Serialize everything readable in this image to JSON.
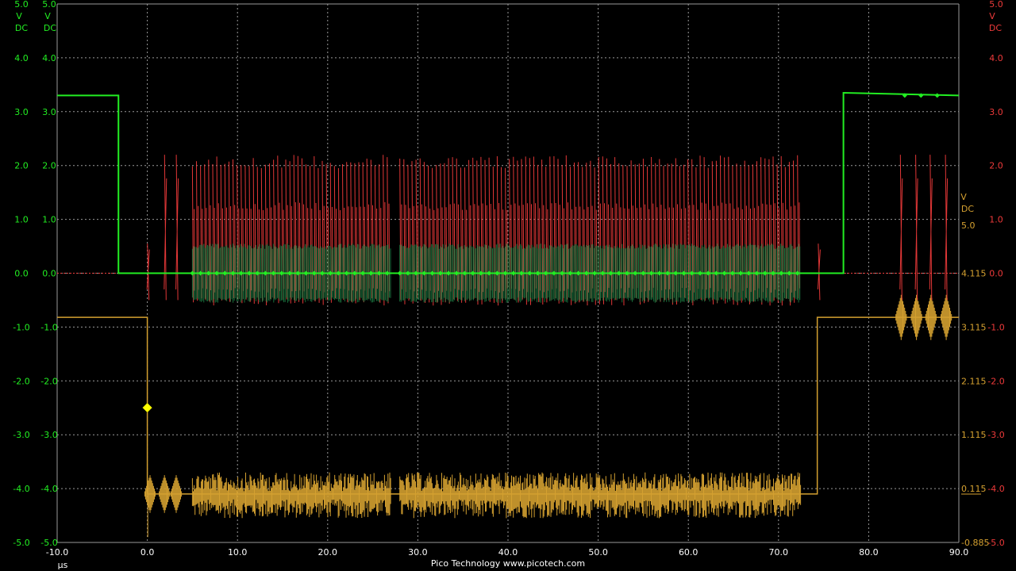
{
  "footer": "Pico Technology  www.picotech.com",
  "colors": {
    "background": "#000000",
    "grid": "#9a9a9a",
    "channel_a": "#22ee22",
    "channel_b": "#ee3a3a",
    "channel_c": "#d4a030",
    "trigger_marker": "#ffff00"
  },
  "chart_data": {
    "type": "line",
    "title": "",
    "grid": true,
    "x": {
      "unit_label": "µs",
      "range": [
        -10,
        90
      ],
      "ticks": [
        "-10.0",
        "0.0",
        "10.0",
        "20.0",
        "30.0",
        "40.0",
        "50.0",
        "60.0",
        "70.0",
        "80.0",
        "90.0"
      ]
    },
    "axes": [
      {
        "id": "A",
        "side": "left",
        "color": "#22ee22",
        "unit": [
          "V",
          "DC"
        ],
        "range": [
          -5,
          5
        ],
        "ticks": [
          "5.0",
          "4.0",
          "3.0",
          "2.0",
          "1.0",
          "0.0",
          "-1.0",
          "-2.0",
          "-3.0",
          "-4.0",
          "-5.0"
        ]
      },
      {
        "id": "A2",
        "side": "left",
        "color": "#22ee22",
        "unit": [
          "V",
          "DC"
        ],
        "range": [
          -5,
          5
        ],
        "ticks": [
          "5.0",
          "4.0",
          "3.0",
          "2.0",
          "1.0",
          "0.0",
          "-1.0",
          "-2.0",
          "-3.0",
          "-4.0",
          "-5.0"
        ]
      },
      {
        "id": "C",
        "side": "right-inner",
        "color": "#d4a030",
        "unit": [
          "V",
          "DC"
        ],
        "range": [
          -0.885,
          5.0
        ],
        "ticks": [
          "5.0",
          "4.115",
          "3.115",
          "2.115",
          "1.115",
          "0.115",
          "-0.885"
        ]
      },
      {
        "id": "B",
        "side": "right",
        "color": "#ee3a3a",
        "unit": [
          "V",
          "DC"
        ],
        "range": [
          -5,
          5
        ],
        "ticks": [
          "5.0",
          "4.0",
          "3.0",
          "2.0",
          "1.0",
          "0.0",
          "-1.0",
          "-2.0",
          "-3.0",
          "-4.0",
          "-5.0"
        ]
      }
    ],
    "trigger": {
      "x": 0.0,
      "y": -2.1,
      "axis": "A"
    },
    "series": [
      {
        "channel": "A",
        "color": "#22ee22",
        "baseline_points": [
          [
            -10,
            3.3
          ],
          [
            -3.2,
            3.3
          ],
          [
            -3.2,
            0.0
          ],
          [
            77.2,
            0.0
          ],
          [
            77.2,
            3.35
          ],
          [
            90,
            3.3
          ]
        ],
        "activity_windows": [
          [
            5,
            27
          ],
          [
            28,
            72.5
          ]
        ],
        "activity_amplitude": [
          -0.1,
          0.1
        ]
      },
      {
        "channel": "B",
        "color": "#ee3a3a",
        "baseline": 0.0,
        "burst_windows": [
          [
            5,
            27
          ],
          [
            28,
            72.5
          ]
        ],
        "burst_period": 0.45,
        "burst_peak": 2.2,
        "burst_trough": -0.6,
        "isolated_spikes": [
          0.1,
          2.0,
          3.3,
          74.5,
          83.6,
          85.3,
          86.9,
          88.6
        ],
        "isolated_spike_peak": 2.2
      },
      {
        "channel": "C",
        "color": "#d4a030",
        "baseline_points": [
          [
            -10,
            -0.82
          ],
          [
            0.0,
            -0.82
          ],
          [
            0.0,
            -4.1
          ],
          [
            74.3,
            -4.1
          ],
          [
            74.3,
            -0.82
          ],
          [
            90,
            -0.82
          ]
        ],
        "noise_windows": [
          [
            5,
            27
          ],
          [
            28,
            72.5
          ]
        ],
        "noise_range": [
          -4.55,
          -3.7
        ],
        "isolated_spikes": [
          0.1,
          1.9,
          3.2,
          83.6,
          85.3,
          86.9,
          88.6
        ],
        "spike_range": [
          -1.25,
          -0.5
        ]
      }
    ]
  }
}
